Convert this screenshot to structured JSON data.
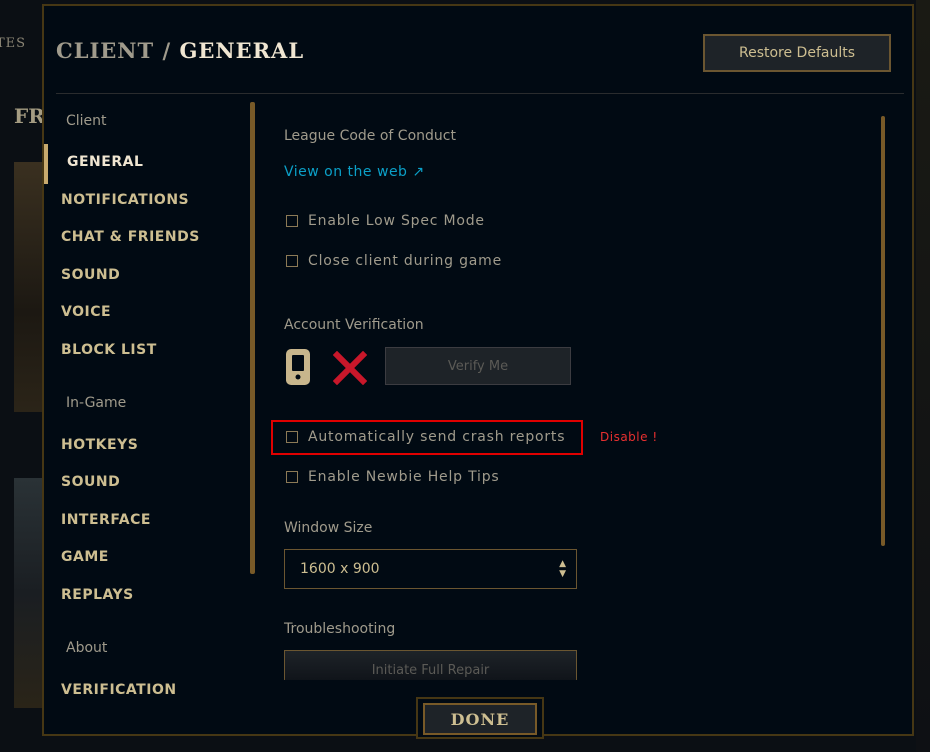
{
  "background": {
    "tab_fragment": "TES",
    "heading_fragment": "FR"
  },
  "header": {
    "section": "CLIENT",
    "separator": " / ",
    "page": "GENERAL",
    "restore_label": "Restore Defaults"
  },
  "sidebar": {
    "client_heading": "Client",
    "client_items": [
      "GENERAL",
      "NOTIFICATIONS",
      "CHAT & FRIENDS",
      "SOUND",
      "VOICE",
      "BLOCK LIST"
    ],
    "ingame_heading": "In-Game",
    "ingame_items": [
      "HOTKEYS",
      "SOUND",
      "INTERFACE",
      "GAME",
      "REPLAYS"
    ],
    "about_heading": "About",
    "about_items": [
      "VERIFICATION"
    ]
  },
  "content": {
    "conduct_label": "League Code of Conduct",
    "conduct_link": "View on the web ↗",
    "low_spec": "Enable Low Spec Mode",
    "close_client": "Close client during game",
    "account_label": "Account Verification",
    "verify_button": "Verify Me",
    "crash_reports": "Automatically send crash reports",
    "annotation": "Disable !",
    "newbie_tips": "Enable Newbie Help Tips",
    "window_size_label": "Window Size",
    "window_size_value": "1600 x 900",
    "troubleshooting_label": "Troubleshooting",
    "repair_button": "Initiate Full Repair"
  },
  "footer": {
    "done_label": "DONE"
  },
  "colors": {
    "gold": "#c8aa6e",
    "gold_text": "#cdbe91",
    "link": "#0ba0c8",
    "annotation_red": "#e00000",
    "panel_bg": "#010a13",
    "verification_fail": "#c8172a"
  }
}
